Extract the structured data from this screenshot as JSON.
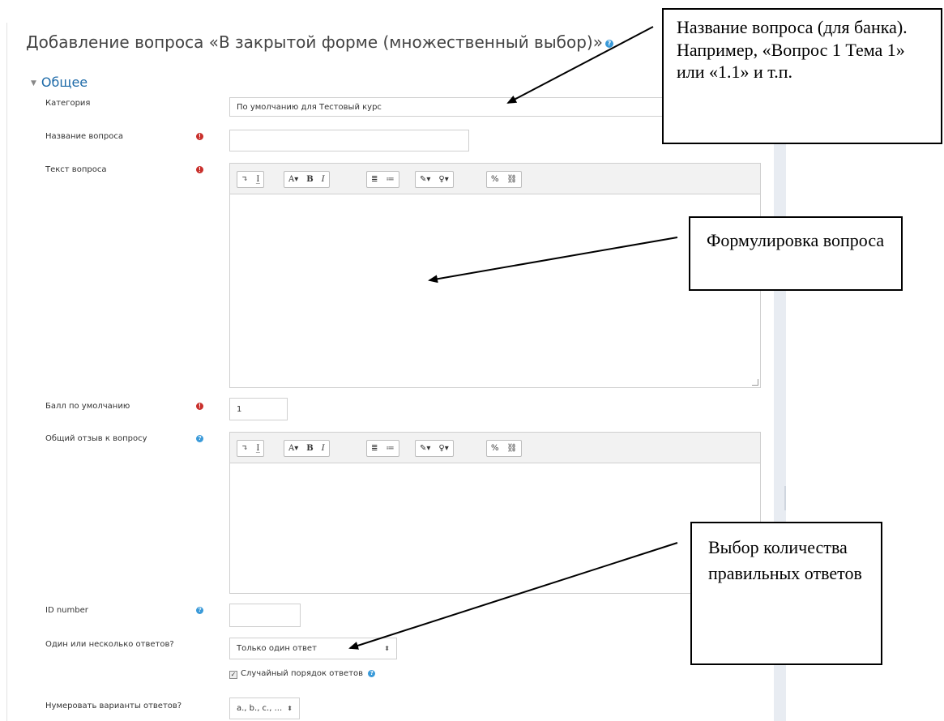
{
  "page": {
    "title": "Добавление вопроса «В закрытой форме (множественный выбор)»"
  },
  "section": {
    "label": "Общее",
    "collapse_icon": "triangle-down-icon"
  },
  "fields": {
    "category": {
      "label": "Категория",
      "value": "По умолчанию для Тестовый курс"
    },
    "question_name": {
      "label": "Название вопроса",
      "value": ""
    },
    "question_text": {
      "label": "Текст вопроса"
    },
    "default_mark": {
      "label": "Балл по умолчанию",
      "value": "1"
    },
    "general_feedback": {
      "label": "Общий отзыв к вопросу"
    },
    "id_number": {
      "label": "ID number",
      "value": ""
    },
    "single_multiple": {
      "label": "Один или несколько ответов?",
      "value": "Только один ответ"
    },
    "shuffle": {
      "label": "Случайный порядок ответов",
      "checked": true
    },
    "numbering": {
      "label": "Нумеровать варианты ответов?",
      "value": "a., b., c., ..."
    }
  },
  "toolbar": {
    "group1": [
      "↴",
      "I̲"
    ],
    "group2": [
      "A▾",
      "B",
      "I"
    ],
    "group3": [
      "≣",
      "≔"
    ],
    "group4": [
      "✎▾",
      "♀▾"
    ],
    "group5": [
      "%",
      "⛓"
    ]
  },
  "icons": {
    "required": "!",
    "help": "?"
  },
  "callouts": {
    "name": "Название вопроса (для банка). Например, «Вопрос 1 Тема 1» или «1.1» и т.п.",
    "text": "Формулировка вопроса",
    "answers": "Выбор количества правильных ответов"
  },
  "colors": {
    "link": "#1d6aa8",
    "required": "#c9302c",
    "help": "#3a9ad9"
  }
}
